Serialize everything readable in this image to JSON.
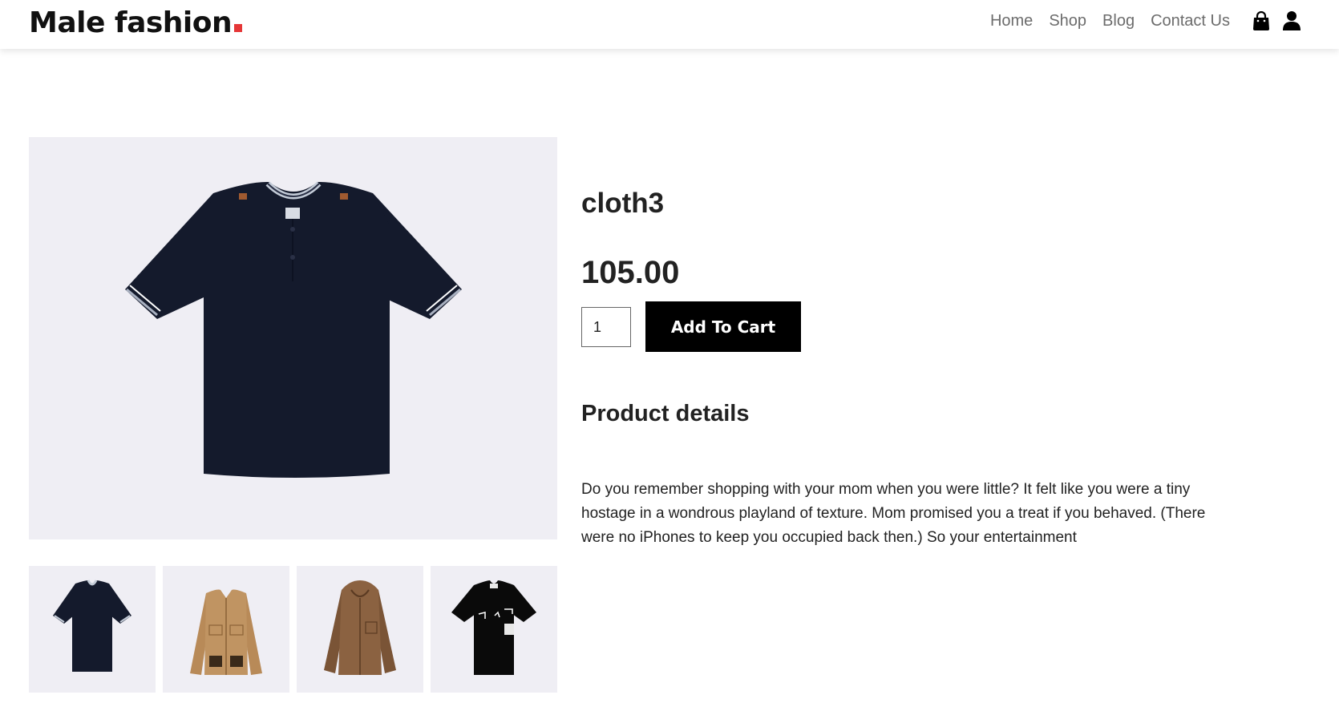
{
  "header": {
    "logo": "Male fashion",
    "nav": [
      {
        "label": "Home"
      },
      {
        "label": "Shop"
      },
      {
        "label": "Blog"
      },
      {
        "label": "Contact Us"
      }
    ],
    "icons": [
      "shopping-bag-icon",
      "user-icon"
    ],
    "accent_color": "#e53637"
  },
  "product": {
    "name": "cloth3",
    "price": "105.00",
    "quantity": "1",
    "add_to_cart_label": "Add To Cart",
    "details_title": "Product details",
    "description": "Do you remember shopping with your mom when you were little? It felt like you were a tiny hostage in a wondrous playland of texture. Mom promised you a treat if you behaved. (There were no iPhones to keep you occupied back then.) So your entertainment"
  },
  "gallery": {
    "main_image": "navy-polo-shirt",
    "thumbnails": [
      "navy-polo-shirt",
      "tan-jacket",
      "brown-hooded-shirt",
      "black-print-tshirt"
    ],
    "background_color": "#efeef4"
  }
}
